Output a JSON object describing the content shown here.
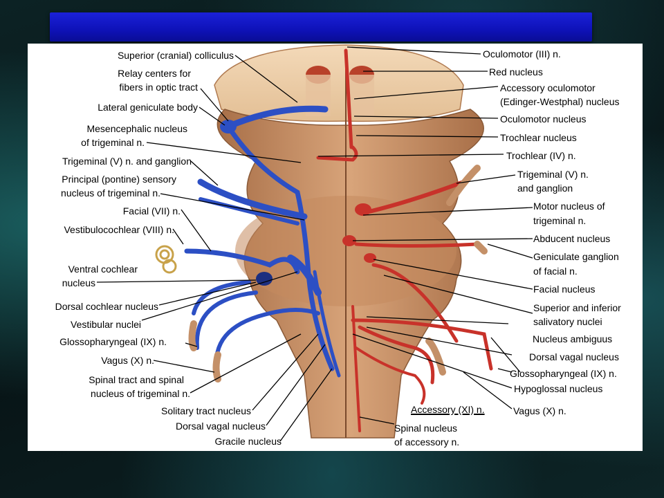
{
  "labels_left": {
    "superior_colliculus": "Superior (cranial) colliculus",
    "relay_centers_1": "Relay centers for",
    "relay_centers_2": "fibers in optic tract",
    "lateral_geniculate": "Lateral geniculate body",
    "mesencephalic_1": "Mesencephalic nucleus",
    "mesencephalic_2": "of trigeminal n.",
    "trigeminal_ganglion": "Trigeminal (V) n. and ganglion",
    "principal_1": "Principal (pontine) sensory",
    "principal_2": "nucleus of trigeminal n.",
    "facial": "Facial (VII) n.",
    "vestibulocochlear": "Vestibulocochlear (VIII) n.",
    "ventral_cochlear_1": "Ventral cochlear",
    "ventral_cochlear_2": "nucleus",
    "dorsal_cochlear": "Dorsal cochlear nucleus",
    "vestibular_nuclei": "Vestibular nuclei",
    "glossopharyngeal": "Glossopharyngeal (IX) n.",
    "vagus": "Vagus (X) n.",
    "spinal_tract_1": "Spinal tract and spinal",
    "spinal_tract_2": "nucleus of trigeminal n.",
    "solitary_tract": "Solitary tract nucleus",
    "dorsal_vagal": "Dorsal vagal nucleus",
    "gracile": "Gracile nucleus"
  },
  "labels_right": {
    "oculomotor_n": "Oculomotor (III) n.",
    "red_nucleus": "Red nucleus",
    "accessory_oculomotor_1": "Accessory oculomotor",
    "accessory_oculomotor_2": "(Edinger-Westphal) nucleus",
    "oculomotor_nucleus": "Oculomotor nucleus",
    "trochlear_nucleus": "Trochlear nucleus",
    "trochlear_n": "Trochlear (IV) n.",
    "trigeminal_1": "Trigeminal (V) n.",
    "trigeminal_2": "and ganglion",
    "motor_trigeminal_1": "Motor nucleus of",
    "motor_trigeminal_2": "trigeminal n.",
    "abducent": "Abducent nucleus",
    "geniculate_1": "Geniculate ganglion",
    "geniculate_2": "of facial n.",
    "facial_nucleus": "Facial nucleus",
    "salivatory_1": "Superior and inferior",
    "salivatory_2": "salivatory nuclei",
    "ambiguus": "Nucleus ambiguus",
    "dorsal_vagal": "Dorsal vagal nucleus",
    "glossopharyngeal": "Glossopharyngeal (IX) n.",
    "hypoglossal": "Hypoglossal nucleus",
    "vagus": "Vagus (X) n.",
    "accessory": "Accessory (XI) n.",
    "spinal_accessory_1": "Spinal nucleus",
    "spinal_accessory_2": "of accessory n."
  },
  "colors": {
    "title_bar": "#1418c8",
    "sensory": "#2c4fc4",
    "motor": "#c8322a",
    "tissue": "#c9936a"
  }
}
